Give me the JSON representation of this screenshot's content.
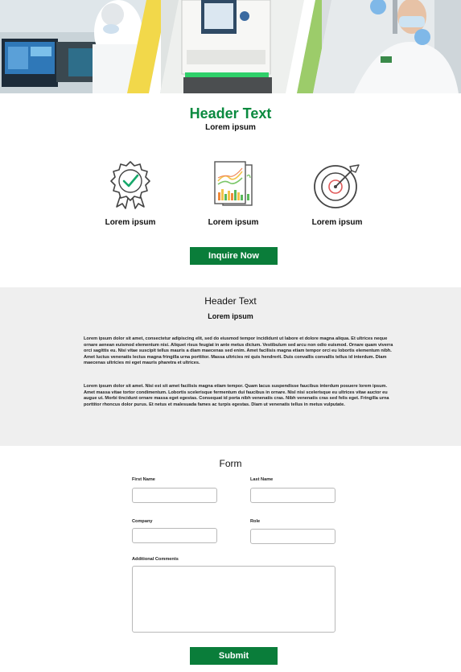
{
  "hero": {
    "image_description": "lab-photo-banner"
  },
  "header": {
    "title": "Header Text",
    "subtitle": "Lorem ipsum"
  },
  "features": [
    {
      "icon": "award-badge-icon",
      "label": "Lorem ipsum"
    },
    {
      "icon": "charts-report-icon",
      "label": "Lorem ipsum"
    },
    {
      "icon": "target-icon",
      "label": "Lorem ipsum"
    }
  ],
  "inquire_button": "Inquire Now",
  "info": {
    "title": "Header Text",
    "subtitle": "Lorem ipsum",
    "paragraph1": "Lorem ipsum dolor sit amet, consectetur adipiscing elit, sed do eiusmod tempor incididunt ut labore et dolore magna aliqua. Et ultrices neque ornare aenean euismod elementum nisi. Aliquet risus feugiat in ante metus dictum. Vestibulum sed arcu non odio euismod. Ornare quam viverra orci sagittis eu. Nisi vitae suscipit tellus mauris a diam maecenas sed enim. Amet facilisis magna etiam tempor orci eu lobortis elementum nibh. Amet luctus venenatis lectus magna fringilla urna porttitor. Massa ultricies mi quis hendrerit. Duis convallis convallis tellus id interdum. Diam maecenas ultricies mi eget mauris pharetra et ultrices.",
    "paragraph2": "Lorem ipsum dolor sit amet. Nisi est sit amet facilisis magna etiam tempor. Quam lacus suspendisse faucibus interdum posuere lorem ipsum. Amet massa vitae tortor condimentum. Lobortis scelerisque fermentum dui faucibus in ornare. Nisl nisi scelerisque eu ultrices vitae auctor eu augue ut. Morbi tincidunt ornare massa eget egestas. Consequat id porta nibh venenatis cras. Nibh venenatis cras sed felis eget. Fringilla urna porttitor rhoncus dolor purus. Et netus et malesuada fames ac turpis egestas. Diam ut venenatis tellus in metus vulputate."
  },
  "form": {
    "title": "Form",
    "first_name_label": "First Name",
    "first_name_value": "",
    "last_name_label": "Last Name",
    "last_name_value": "",
    "company_label": "Company",
    "company_value": "",
    "role_label": "Role",
    "role_value": "",
    "comments_label": "Additional Comments",
    "comments_value": "",
    "submit_label": "Submit"
  },
  "colors": {
    "brand_green": "#0a7d3a",
    "title_green": "#0a8a3f",
    "accent_yellow": "#f2d84a",
    "accent_light_green": "#9ccc6a",
    "section_grey": "#efefef"
  }
}
